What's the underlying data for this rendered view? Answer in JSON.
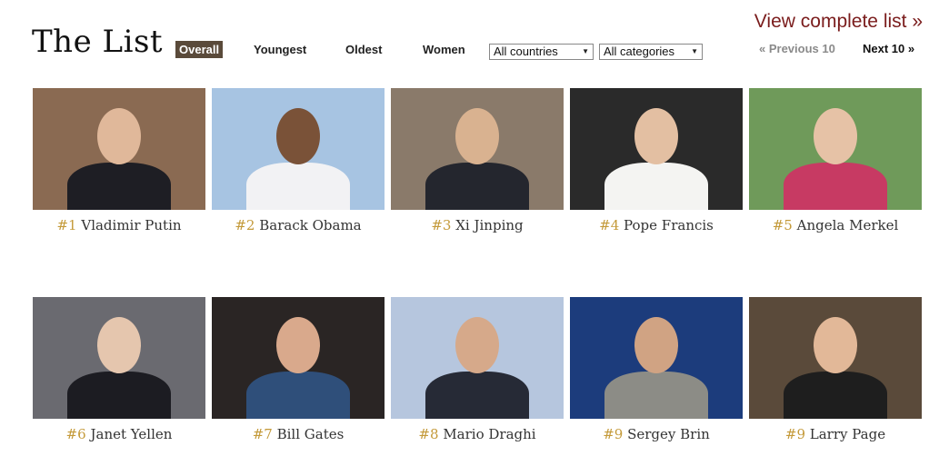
{
  "page": {
    "title": "The List"
  },
  "tabs": [
    {
      "label": "Overall",
      "active": true
    },
    {
      "label": "Youngest",
      "active": false
    },
    {
      "label": "Oldest",
      "active": false
    },
    {
      "label": "Women",
      "active": false
    }
  ],
  "filters": {
    "country": "All countries",
    "category": "All categories"
  },
  "links": {
    "view_complete": "View complete list »",
    "previous": "« Previous 10",
    "next": "Next 10 »"
  },
  "people": [
    {
      "rank": "#1",
      "name": "Vladimir Putin",
      "bg": "#8a6a52",
      "skin": "#e0b89a",
      "clothes": "#1e1e24"
    },
    {
      "rank": "#2",
      "name": "Barack Obama",
      "bg": "#a7c4e2",
      "skin": "#7a5238",
      "clothes": "#f2f2f4"
    },
    {
      "rank": "#3",
      "name": "Xi Jinping",
      "bg": "#8a7a6a",
      "skin": "#d9b290",
      "clothes": "#24262e"
    },
    {
      "rank": "#4",
      "name": "Pope Francis",
      "bg": "#2a2a2a",
      "skin": "#e3bfa2",
      "clothes": "#f4f4f2"
    },
    {
      "rank": "#5",
      "name": "Angela Merkel",
      "bg": "#6f9a5a",
      "skin": "#e6c2a6",
      "clothes": "#c73a63"
    },
    {
      "rank": "#6",
      "name": "Janet Yellen",
      "bg": "#6a6a70",
      "skin": "#e5c6ae",
      "clothes": "#1c1c22"
    },
    {
      "rank": "#7",
      "name": "Bill Gates",
      "bg": "#2a2524",
      "skin": "#d9a98c",
      "clothes": "#2f4f7a"
    },
    {
      "rank": "#8",
      "name": "Mario Draghi",
      "bg": "#b6c6de",
      "skin": "#d6a98a",
      "clothes": "#262a36"
    },
    {
      "rank": "#9",
      "name": "Sergey Brin",
      "bg": "#1c3c7c",
      "skin": "#d0a383",
      "clothes": "#8c8c86"
    },
    {
      "rank": "#9",
      "name": "Larry Page",
      "bg": "#5a4a3a",
      "skin": "#e2b898",
      "clothes": "#1e1e1e"
    }
  ]
}
